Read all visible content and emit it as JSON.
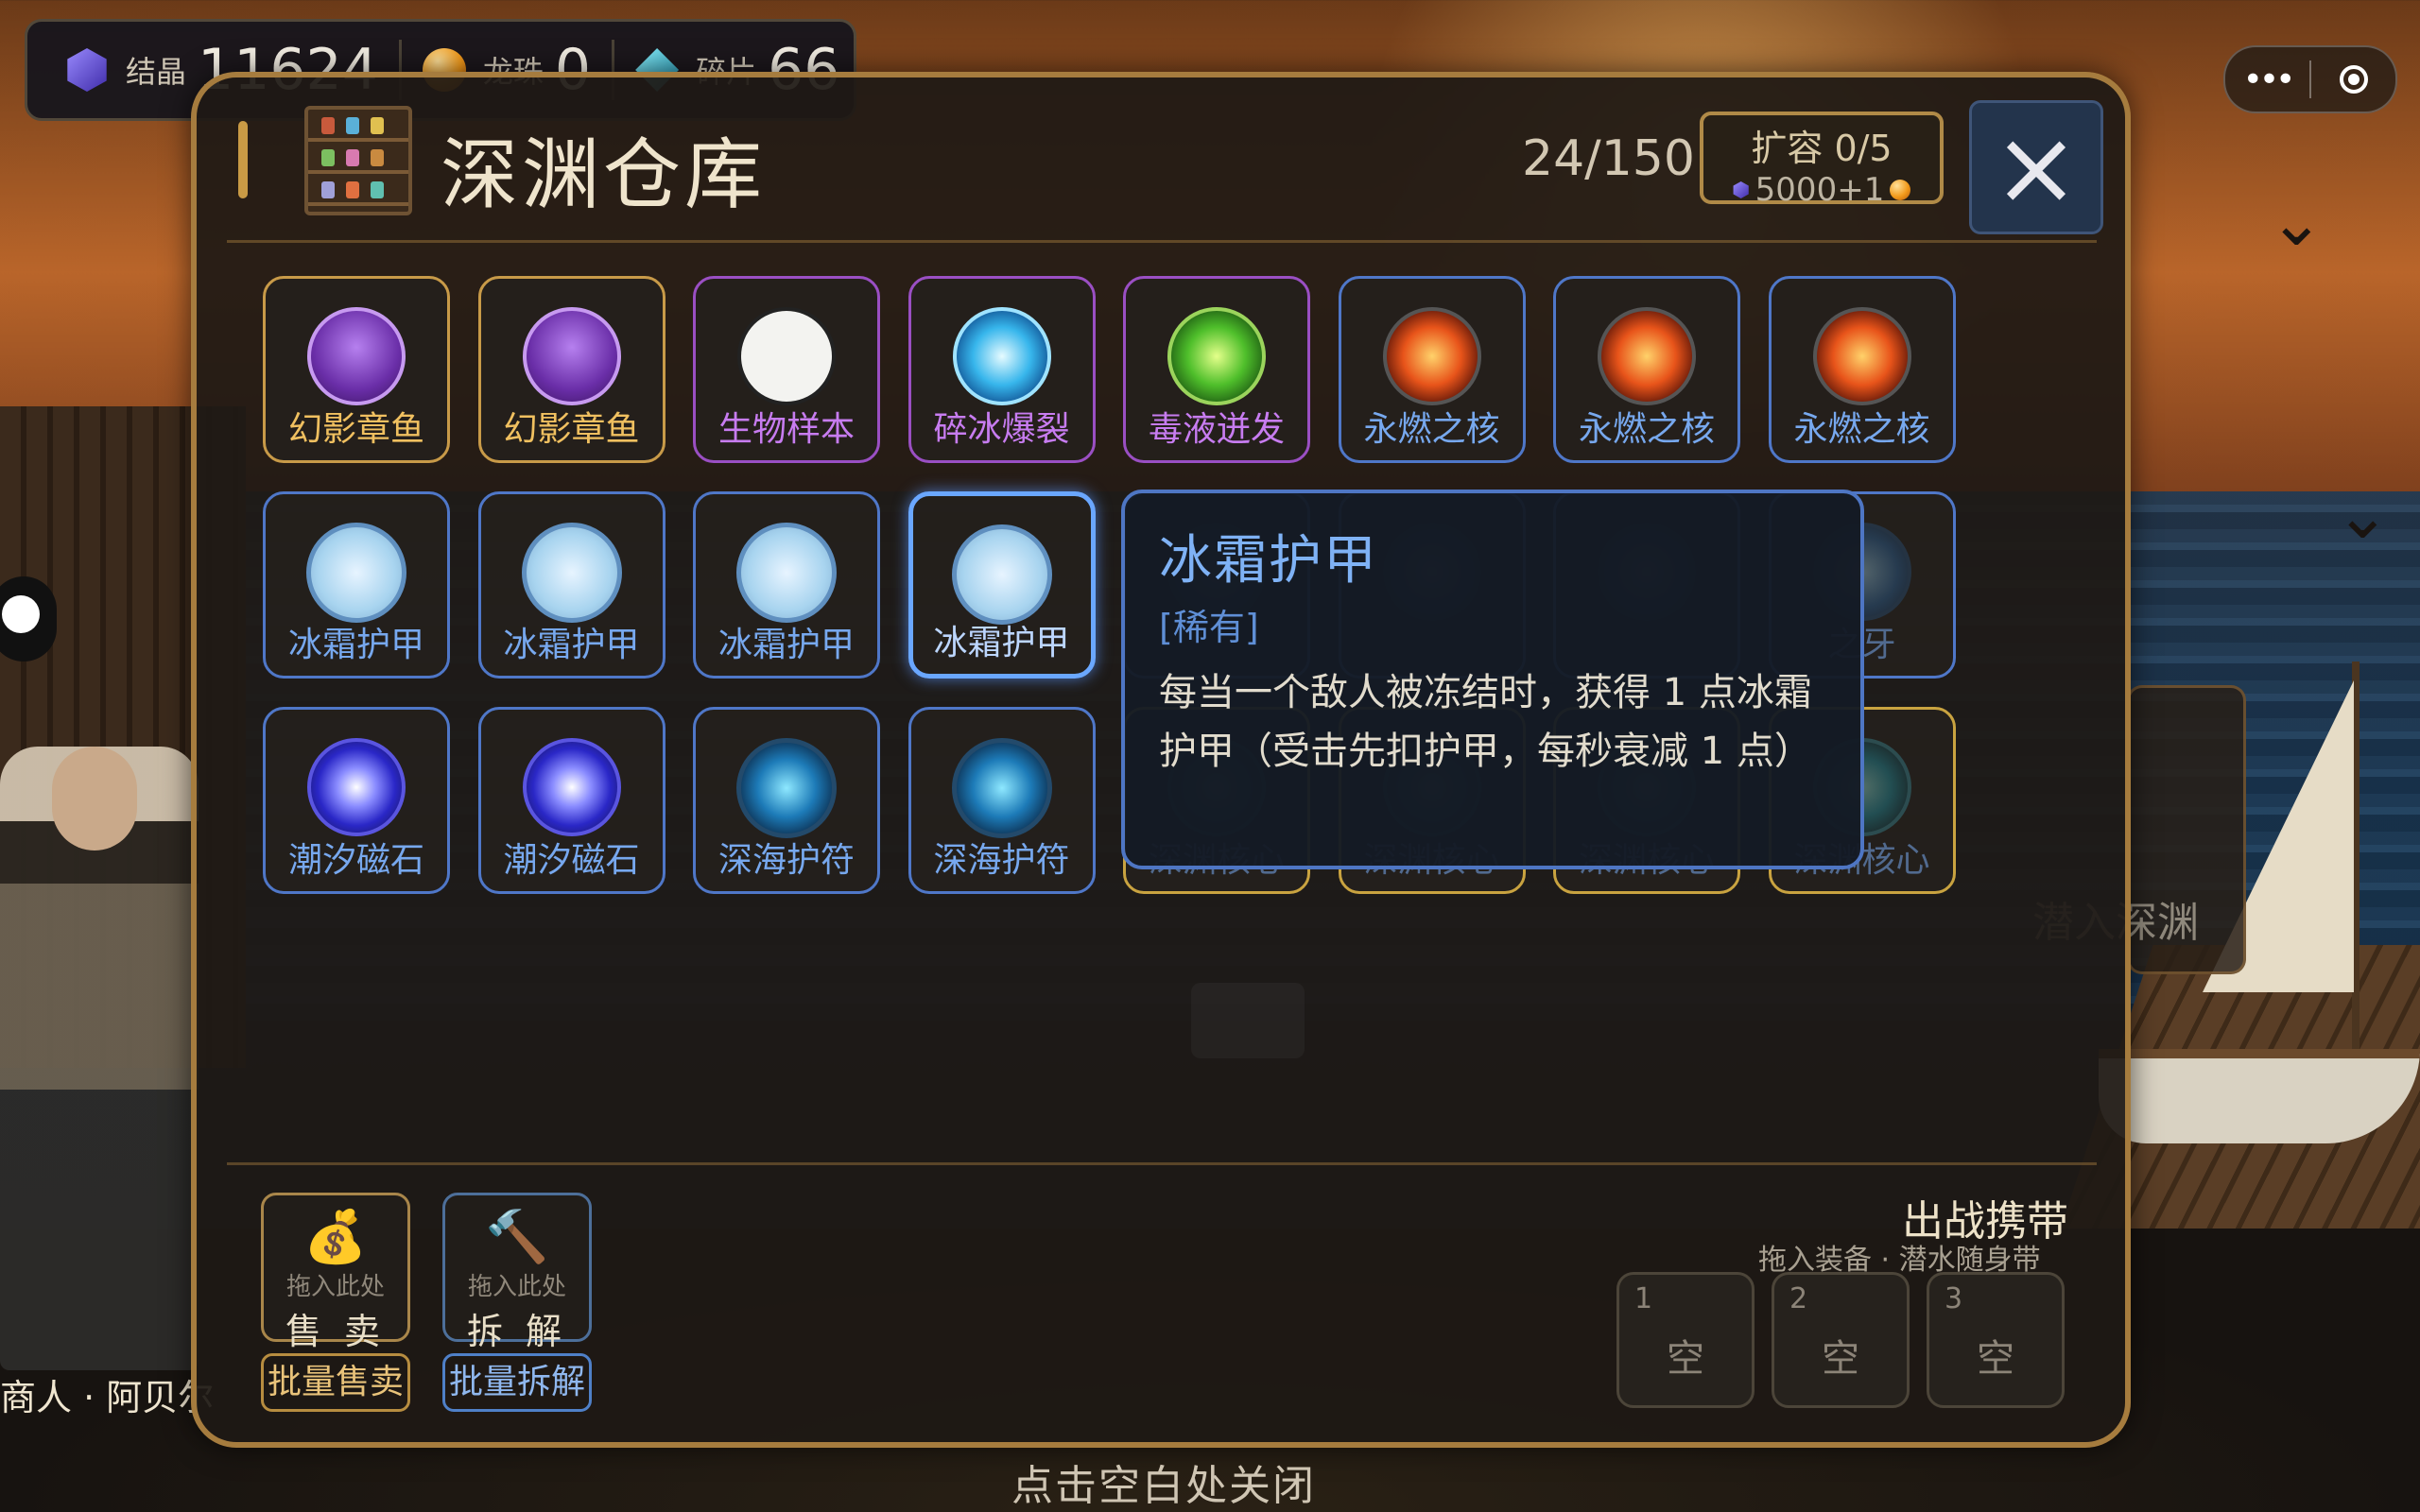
{
  "currency": [
    {
      "label": "结晶",
      "value": "11624",
      "icon": "crystal-icon",
      "color": "#6b5cff"
    },
    {
      "label": "龙珠",
      "value": "0",
      "icon": "dragon-ball-icon",
      "color": "#f29a1b"
    },
    {
      "label": "碎片",
      "value": "66",
      "icon": "shard-icon",
      "color": "#2fb6d6"
    }
  ],
  "capsule": {
    "more": "•••"
  },
  "warehouse": {
    "title": "深渊仓库",
    "capacity": "24/150",
    "expand": {
      "label": "扩容 0/5",
      "cost": "5000+1"
    },
    "close": "×"
  },
  "items": [
    {
      "name": "幻影章鱼",
      "quality": "legend",
      "icon": "octopus-icon"
    },
    {
      "name": "幻影章鱼",
      "quality": "legend",
      "icon": "octopus-icon"
    },
    {
      "name": "生物样本",
      "quality": "epic",
      "icon": "dna-sample-icon"
    },
    {
      "name": "碎冰爆裂",
      "quality": "epic",
      "icon": "ice-burst-icon"
    },
    {
      "name": "毒液迸发",
      "quality": "epic",
      "icon": "poison-burst-icon"
    },
    {
      "name": "永燃之核",
      "quality": "rare",
      "icon": "fire-core-icon"
    },
    {
      "name": "永燃之核",
      "quality": "rare",
      "icon": "fire-core-icon"
    },
    {
      "name": "永燃之核",
      "quality": "rare",
      "icon": "fire-core-icon"
    },
    {
      "name": "冰霜护甲",
      "quality": "rare",
      "icon": "frost-shield-icon"
    },
    {
      "name": "冰霜护甲",
      "quality": "rare",
      "icon": "frost-shield-icon"
    },
    {
      "name": "冰霜护甲",
      "quality": "rare",
      "icon": "frost-shield-icon"
    },
    {
      "name": "冰霜护甲",
      "quality": "rare",
      "icon": "frost-shield-icon",
      "selected": true
    },
    {
      "name": "",
      "quality": "rare",
      "icon": "fang-icon"
    },
    {
      "name": "",
      "quality": "rare",
      "icon": "fang-icon"
    },
    {
      "name": "",
      "quality": "rare",
      "icon": "fang-icon"
    },
    {
      "name": "之牙",
      "quality": "rare",
      "icon": "fang-icon"
    },
    {
      "name": "潮汐磁石",
      "quality": "rare",
      "icon": "vortex-icon"
    },
    {
      "name": "潮汐磁石",
      "quality": "rare",
      "icon": "vortex-icon"
    },
    {
      "name": "深海护符",
      "quality": "rare",
      "icon": "amulet-icon"
    },
    {
      "name": "深海护符",
      "quality": "rare",
      "icon": "amulet-icon"
    },
    {
      "name": "深渊核心",
      "quality": "gold",
      "icon": "abyss-core-icon"
    },
    {
      "name": "深渊核心",
      "quality": "gold",
      "icon": "abyss-core-icon"
    },
    {
      "name": "深渊核心",
      "quality": "gold",
      "icon": "abyss-core-icon"
    },
    {
      "name": "深渊核心",
      "quality": "gold",
      "icon": "abyss-core-icon"
    }
  ],
  "tooltip": {
    "name": "冰霜护甲",
    "rarity": "[稀有]",
    "description": "每当一个敌人被冻结时，获得 1 点冰霜护甲（受击先扣护甲，每秒衰减 1 点）"
  },
  "actions": {
    "sell": {
      "hint": "拖入此处",
      "label": "售 卖",
      "icon": "money-bag-icon"
    },
    "dismantle": {
      "hint": "拖入此处",
      "label": "拆 解",
      "icon": "hammer-icon"
    },
    "batch_sell": "批量售卖",
    "batch_dismantle": "批量拆解"
  },
  "loadout": {
    "title": "出战携带",
    "subtitle": "拖入装备 · 潜水随身带",
    "slots": [
      {
        "num": "1",
        "label": "空"
      },
      {
        "num": "2",
        "label": "空"
      },
      {
        "num": "3",
        "label": "空"
      }
    ]
  },
  "background": {
    "npc_name": "商人 · 阿贝尔",
    "dive_button": "潜入深渊"
  },
  "close_hint": "点击空白处关闭",
  "colors": {
    "panel_border": "#a67c3e",
    "legend": "#f0c060",
    "epic": "#c77cf0",
    "rare": "#77a8ee",
    "selected": "#6aa7ff"
  }
}
